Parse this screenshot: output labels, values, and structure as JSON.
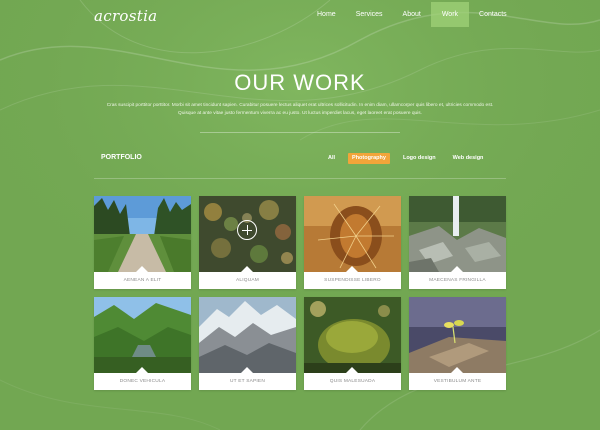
{
  "header": {
    "logo": "acrostia",
    "nav": [
      "Home",
      "Services",
      "About",
      "Work",
      "Contacts"
    ],
    "active_nav": "Work"
  },
  "hero": {
    "title": "OUR WORK",
    "description": "Cras suscipit porttitor porttitor. Morbi sit amet tincidunt sapien. Curabitur posuere lectus aliquet erat ultrices sollicitudin. In enim diam, ullamcorper quis libero et, ultricies commodo est. Quisque at ante vitae justo fermentum viverra ac eu justo. Ut luctus imperdiet lacus, eget laoreet erat posuere quis."
  },
  "portfolio": {
    "label": "PORTFOLIO",
    "filters": [
      "All",
      "Photography",
      "Logo design",
      "Web design"
    ],
    "active_filter": "Photography",
    "items": [
      {
        "caption": "AENEAN A ELIT",
        "image": "forest-path"
      },
      {
        "caption": "ALIQUAM",
        "image": "bokeh-lights"
      },
      {
        "caption": "SUSPENDISSE LIBERO",
        "image": "cactus-spines"
      },
      {
        "caption": "MAECENAS FRINGILLA",
        "image": "waterfall-rocks"
      },
      {
        "caption": "DONEC VEHICULA",
        "image": "mountain-valley"
      },
      {
        "caption": "UT ET SAPIEN",
        "image": "rocky-mountains"
      },
      {
        "caption": "QUIS MALESUADA",
        "image": "mossy-rock"
      },
      {
        "caption": "VESTIBULUM ANTE",
        "image": "sprout-on-log"
      }
    ]
  },
  "colors": {
    "background": "#72a752",
    "active_nav": "#a0d278",
    "active_filter": "#f2a53a",
    "caption_text": "#8a8a8a"
  }
}
